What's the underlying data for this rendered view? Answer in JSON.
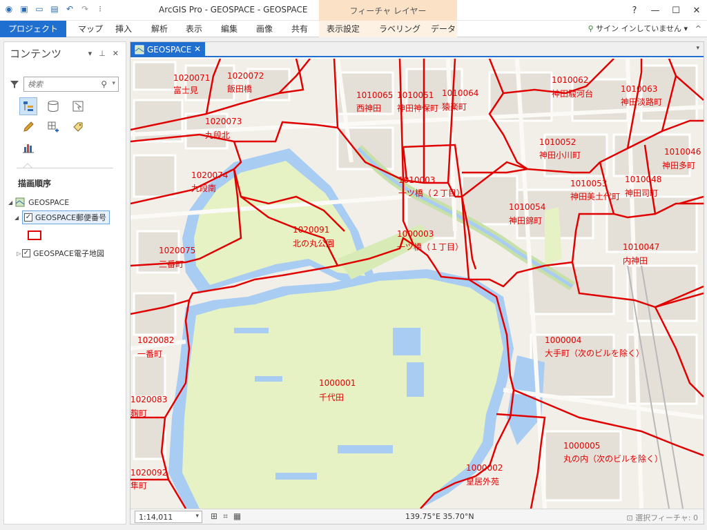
{
  "titlebar": {
    "title": "ArcGIS Pro - GEOSPACE - GEOSPACE",
    "contextual_header": "フィーチャ レイヤー",
    "help": "?",
    "minimize": "—",
    "maximize": "☐",
    "close": "✕",
    "qat_icons": [
      "arcgis-logo-icon",
      "new-project-icon",
      "open-project-icon",
      "save-icon",
      "undo-icon",
      "redo-icon",
      "customize-qat-icon"
    ]
  },
  "ribbon": {
    "tabs": [
      "プロジェクト",
      "マップ",
      "挿入",
      "解析",
      "表示",
      "編集",
      "画像",
      "共有",
      "表示設定",
      "ラベリング",
      "データ"
    ],
    "signin": "サイン インしていません",
    "signin_caret": "▾",
    "collapse": "^"
  },
  "contents": {
    "title": "コンテンツ",
    "pane_controls": [
      "▾",
      "⊥",
      "✕"
    ],
    "search_placeholder": "検索",
    "drawing_order_label": "描画順序",
    "layers": {
      "map": "GEOSPACE",
      "layer1": "GEOSPACE郵便番号",
      "layer2": "GEOSPACE電子地図"
    }
  },
  "map_view": {
    "tab_label": "GEOSPACE",
    "tab_close": "✕",
    "tab_list_caret": "▾",
    "zones": [
      {
        "code": "1020071",
        "name": "富士見"
      },
      {
        "code": "1020072",
        "name": "飯田橋"
      },
      {
        "code": "1020073",
        "name": "九段北"
      },
      {
        "code": "1010065",
        "name": "西神田"
      },
      {
        "code": "1010051",
        "name": "神田神保町"
      },
      {
        "code": "1010064",
        "name": "猿楽町"
      },
      {
        "code": "1010062",
        "name": "神田駿河台"
      },
      {
        "code": "1010063",
        "name": "神田淡路町"
      },
      {
        "code": "1010052",
        "name": "神田小川町"
      },
      {
        "code": "1010046",
        "name": "神田多町"
      },
      {
        "code": "1010003",
        "name": "一ツ橋（２丁目）"
      },
      {
        "code": "1010053",
        "name": "神田美土代町"
      },
      {
        "code": "1010048",
        "name": "神田司町"
      },
      {
        "code": "1020074",
        "name": "九段南"
      },
      {
        "code": "1010054",
        "name": "神田錦町"
      },
      {
        "code": "1020091",
        "name": "北の丸公園"
      },
      {
        "code": "1000003",
        "name": "一ツ橋（１丁目）"
      },
      {
        "code": "1010047",
        "name": "内神田"
      },
      {
        "code": "1020075",
        "name": "三番町"
      },
      {
        "code": "1020082",
        "name": "一番町"
      },
      {
        "code": "1000004",
        "name": "大手町（次のビルを除く）"
      },
      {
        "code": "1000001",
        "name": "千代田"
      },
      {
        "code": "1020083",
        "name": "麹町"
      },
      {
        "code": "1000005",
        "name": "丸の内（次のビルを除く）"
      },
      {
        "code": "1000002",
        "name": "皇居外苑"
      },
      {
        "code": "1020092",
        "name": "隼町"
      }
    ]
  },
  "statusbar": {
    "scale": "1:14,011",
    "coords": "139.75°E 35.70°N",
    "selected": "選択フィーチャ: 0"
  },
  "colors": {
    "accent": "#1f6fd1",
    "boundary": "#e00000",
    "park": "#e6f2c4",
    "water": "#a9cdf2",
    "contextual": "#fbe2c6"
  }
}
